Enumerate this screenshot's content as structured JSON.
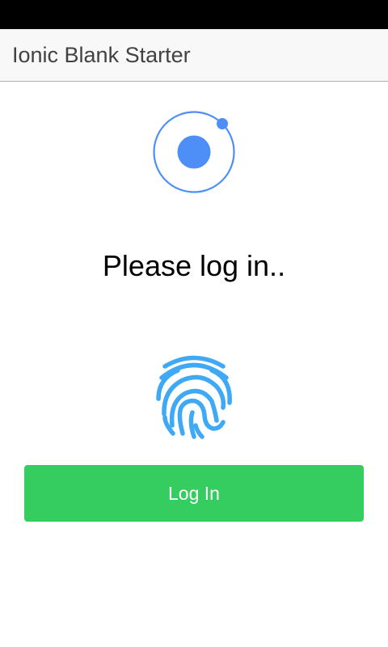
{
  "header": {
    "title": "Ionic Blank Starter"
  },
  "main": {
    "logo_icon": "ionic-logo-icon",
    "heading": "Please log in..",
    "fingerprint_icon": "fingerprint-icon",
    "login_button_label": "Log In"
  },
  "colors": {
    "toolbar_bg": "#f8f8f8",
    "logo_blue": "#4e8ef7",
    "fingerprint_blue": "#3fa9f5",
    "button_green": "#35cd60"
  }
}
